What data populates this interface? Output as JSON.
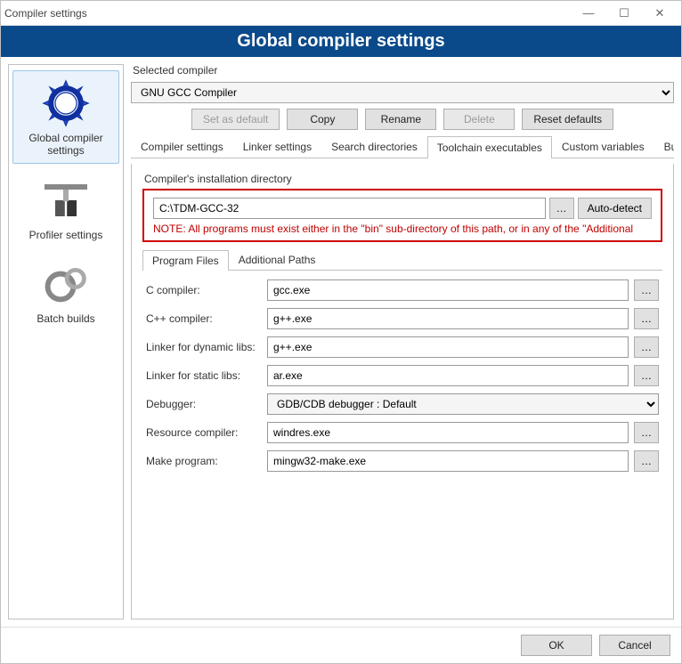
{
  "window": {
    "title": "Compiler settings"
  },
  "header": {
    "title": "Global compiler settings"
  },
  "sidebar": {
    "items": [
      {
        "label": "Global compiler settings"
      },
      {
        "label": "Profiler settings"
      },
      {
        "label": "Batch builds"
      }
    ]
  },
  "selected_compiler": {
    "label": "Selected compiler",
    "value": "GNU GCC Compiler",
    "buttons": {
      "set_default": "Set as default",
      "copy": "Copy",
      "rename": "Rename",
      "delete": "Delete",
      "reset": "Reset defaults"
    }
  },
  "tabs": [
    {
      "label": "Compiler settings"
    },
    {
      "label": "Linker settings"
    },
    {
      "label": "Search directories"
    },
    {
      "label": "Toolchain executables"
    },
    {
      "label": "Custom variables"
    },
    {
      "label": "Build"
    }
  ],
  "toolchain": {
    "legend": "Compiler's installation directory",
    "path": "C:\\TDM-GCC-32",
    "browse": "…",
    "autodetect": "Auto-detect",
    "note": "NOTE: All programs must exist either in the \"bin\" sub-directory of this path, or in any of the \"Additional"
  },
  "subtabs": [
    {
      "label": "Program Files"
    },
    {
      "label": "Additional Paths"
    }
  ],
  "programs": {
    "c_compiler": {
      "label": "C compiler:",
      "value": "gcc.exe"
    },
    "cpp_compiler": {
      "label": "C++ compiler:",
      "value": "g++.exe"
    },
    "linker_dyn": {
      "label": "Linker for dynamic libs:",
      "value": "g++.exe"
    },
    "linker_static": {
      "label": "Linker for static libs:",
      "value": "ar.exe"
    },
    "debugger": {
      "label": "Debugger:",
      "value": "GDB/CDB debugger : Default"
    },
    "resource": {
      "label": "Resource compiler:",
      "value": "windres.exe"
    },
    "make": {
      "label": "Make program:",
      "value": "mingw32-make.exe"
    }
  },
  "footer": {
    "ok": "OK",
    "cancel": "Cancel"
  }
}
